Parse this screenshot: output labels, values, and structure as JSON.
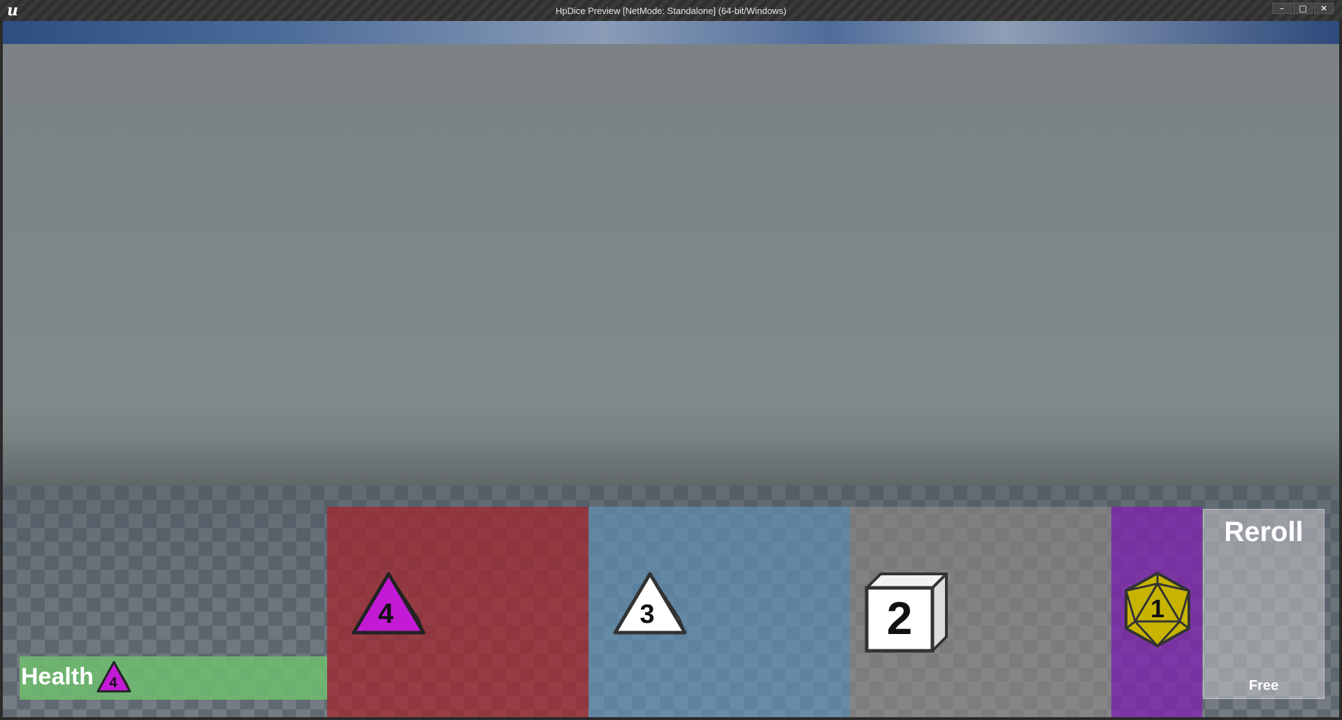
{
  "window": {
    "title": "HpDice Preview [NetMode: Standalone]  (64-bit/Windows)",
    "logo_text": "u",
    "minimize_glyph": "–",
    "maximize_glyph": "□",
    "close_glyph": "✕"
  },
  "hud": {
    "dice_slots": [
      {
        "value": "4",
        "die": "d4",
        "color": "#c31ad6",
        "slot_color": "#a82028"
      },
      {
        "value": "3",
        "die": "d4",
        "color": "#ffffff",
        "slot_color": "#5f96be"
      },
      {
        "value": "2",
        "die": "d6",
        "color": "#ffffff",
        "slot_color": "#968e8a"
      },
      {
        "value": "1",
        "die": "d20",
        "color": "#c8b400",
        "slot_color": "#821eb4"
      }
    ],
    "reroll": {
      "title": "Reroll",
      "cost": "Free"
    },
    "health": {
      "label": "Health",
      "die_value": "4",
      "bar_color": "#6ebe6e"
    }
  }
}
